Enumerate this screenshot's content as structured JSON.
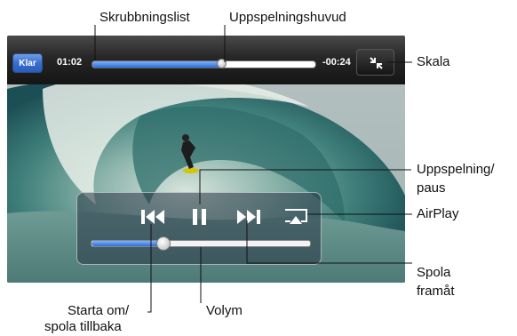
{
  "player": {
    "done_label": "Klar",
    "time_elapsed": "01:02",
    "time_remaining": "-00:24",
    "playback_progress": 0.58,
    "volume_level": 0.33,
    "accent_color": "#2d6fd6",
    "icons": {
      "scale": "shrink-icon",
      "previous": "skip-back-icon",
      "play_pause": "pause-icon",
      "next": "skip-forward-icon",
      "airplay": "airplay-icon"
    }
  },
  "callouts": {
    "scrubber": "Skrubbningslist",
    "playhead": "Uppspelningshuvud",
    "scale": "Skala",
    "play_pause_line1": "Uppspelning/",
    "play_pause_line2": "paus",
    "airplay": "AirPlay",
    "fast_forward_line1": "Spola",
    "fast_forward_line2": "framåt",
    "restart_line1": "Starta om/",
    "restart_line2": "spola tillbaka",
    "volume": "Volym"
  }
}
